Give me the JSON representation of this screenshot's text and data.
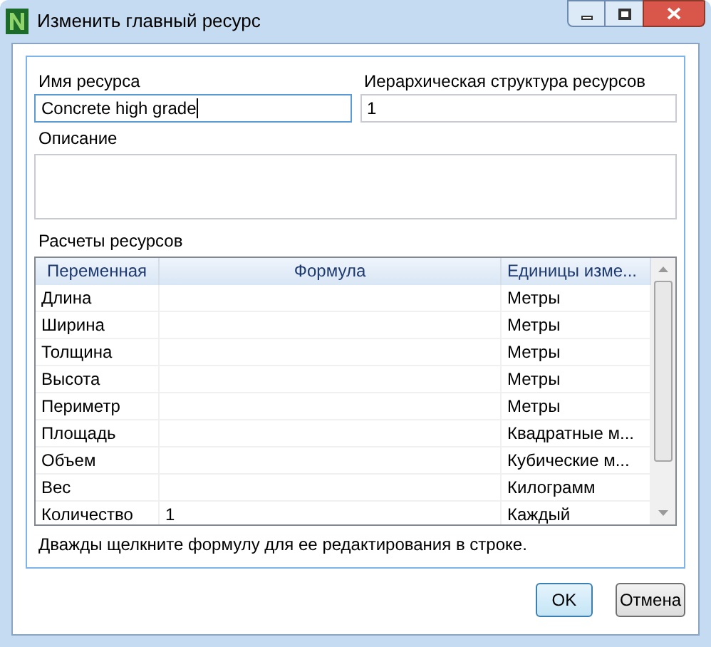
{
  "window": {
    "title": "Изменить главный ресурс"
  },
  "fields": [
    {
      "label": "Имя ресурса",
      "value": "Concrete high grade",
      "focused": true
    },
    {
      "label": "Иерархическая структура ресурсов",
      "value": "1",
      "focused": false
    }
  ],
  "description": {
    "label": "Описание"
  },
  "calculations": {
    "label": "Расчеты ресурсов",
    "columns": [
      "Переменная",
      "Формула",
      "Единицы изме..."
    ],
    "rows": [
      [
        "Длина",
        "",
        "Метры"
      ],
      [
        "Ширина",
        "",
        "Метры"
      ],
      [
        "Толщина",
        "",
        "Метры"
      ],
      [
        "Высота",
        "",
        "Метры"
      ],
      [
        "Периметр",
        "",
        "Метры"
      ],
      [
        "Площадь",
        "",
        "Квадратные м..."
      ],
      [
        "Объем",
        "",
        "Кубические м..."
      ],
      [
        "Вес",
        "",
        "Килограмм"
      ],
      [
        "Количество",
        "1",
        "Каждый"
      ]
    ]
  },
  "hint": "Дважды щелкните формулу для ее редактирования в строке.",
  "buttons": [
    {
      "label": "OK",
      "default": true
    },
    {
      "label": "Отмена",
      "default": false
    }
  ]
}
